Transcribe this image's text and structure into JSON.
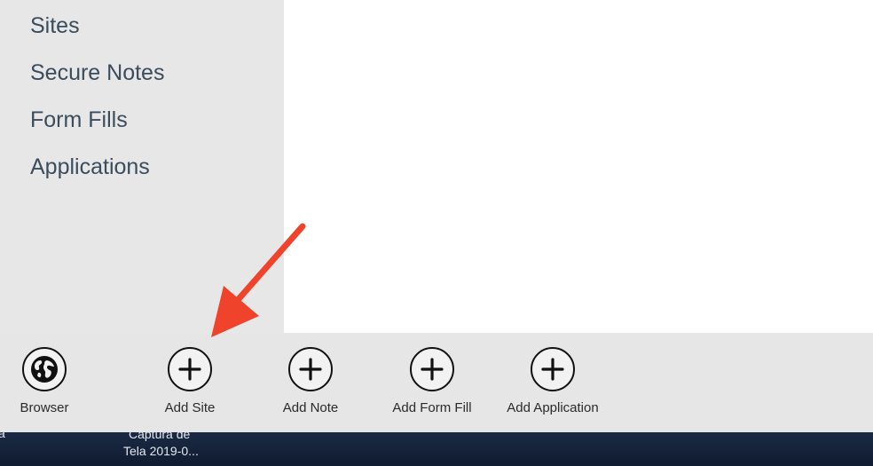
{
  "sidebar": {
    "items": [
      {
        "label": "Sites"
      },
      {
        "label": "Secure Notes"
      },
      {
        "label": "Form Fills"
      },
      {
        "label": "Applications"
      }
    ]
  },
  "appbar": {
    "buttons": [
      {
        "label": "Browser",
        "icon": "globe-icon"
      },
      {
        "label": "Add Site",
        "icon": "plus-circle-icon"
      },
      {
        "label": "Add Note",
        "icon": "plus-circle-icon"
      },
      {
        "label": "Add Form Fill",
        "icon": "plus-circle-icon"
      },
      {
        "label": "Add Application",
        "icon": "plus-circle-icon"
      }
    ]
  },
  "taskbar": {
    "edge_char": "a",
    "item_line1": "Captura de",
    "item_line2": "Tela 2019-0..."
  },
  "colors": {
    "sidebar_bg": "#e7e7e7",
    "sidebar_text": "#3b4c5c",
    "appbar_bg": "#e6e6e6",
    "taskbar_bg": "#13213a",
    "annotation_arrow": "#f0432c"
  }
}
